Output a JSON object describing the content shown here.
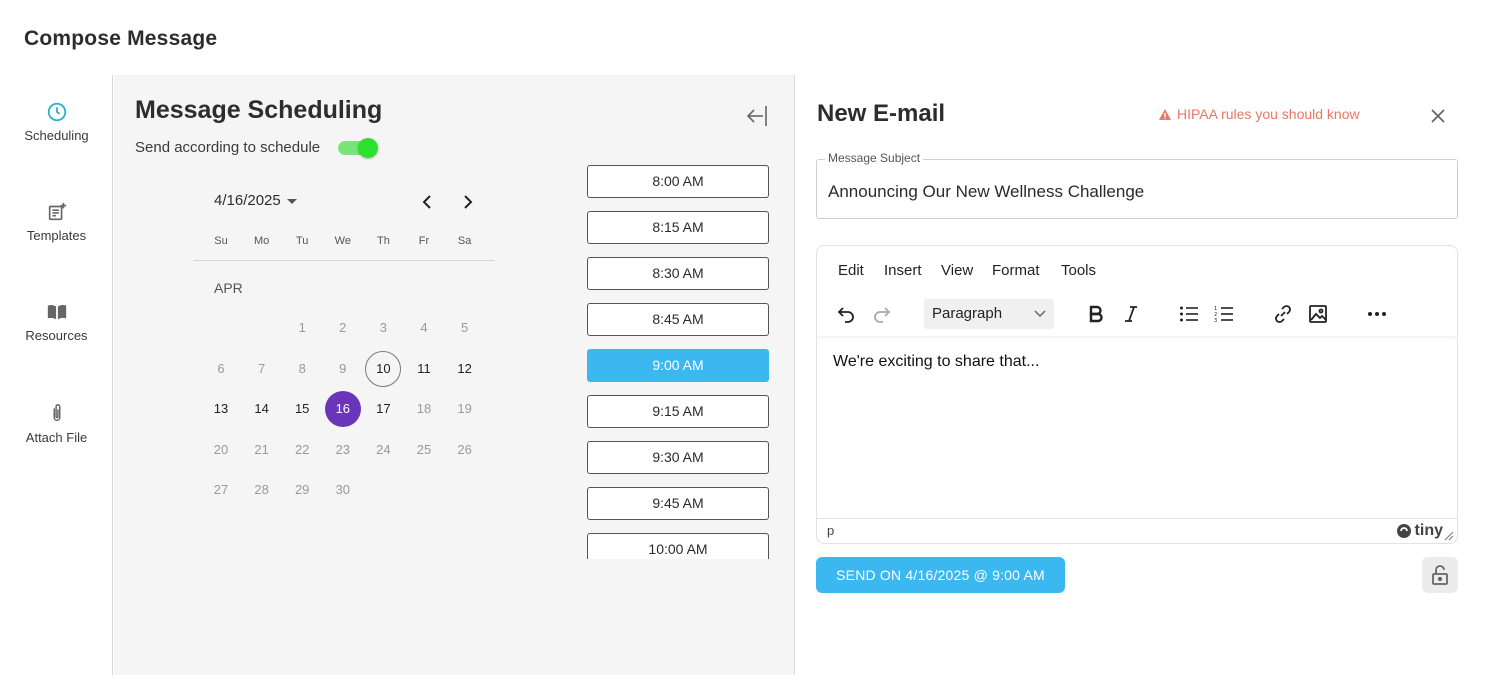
{
  "page": {
    "title": "Compose Message"
  },
  "rail": {
    "items": [
      {
        "label": "Scheduling",
        "icon": "clock-icon",
        "active": true
      },
      {
        "label": "Templates",
        "icon": "template-icon"
      },
      {
        "label": "Resources",
        "icon": "book-icon"
      },
      {
        "label": "Attach File",
        "icon": "paperclip-icon"
      }
    ]
  },
  "scheduling": {
    "title": "Message Scheduling",
    "toggle_label": "Send according to schedule",
    "toggle_on": true,
    "selected_date": "4/16/2025",
    "weekdays": [
      "Su",
      "Mo",
      "Tu",
      "We",
      "Th",
      "Fr",
      "Sa"
    ],
    "month_label": "APR",
    "days": [
      {
        "d": "1",
        "s": "muted"
      },
      {
        "d": "2",
        "s": "muted"
      },
      {
        "d": "3",
        "s": "muted"
      },
      {
        "d": "4",
        "s": "muted"
      },
      {
        "d": "5",
        "s": "muted"
      },
      {
        "d": "6",
        "s": "muted"
      },
      {
        "d": "7",
        "s": "muted"
      },
      {
        "d": "8",
        "s": "muted"
      },
      {
        "d": "9",
        "s": "muted"
      },
      {
        "d": "10",
        "s": "today"
      },
      {
        "d": "11",
        "s": "normal"
      },
      {
        "d": "12",
        "s": "normal"
      },
      {
        "d": "13",
        "s": "normal"
      },
      {
        "d": "14",
        "s": "normal"
      },
      {
        "d": "15",
        "s": "normal"
      },
      {
        "d": "16",
        "s": "selected"
      },
      {
        "d": "17",
        "s": "normal"
      },
      {
        "d": "18",
        "s": "muted"
      },
      {
        "d": "19",
        "s": "muted"
      },
      {
        "d": "20",
        "s": "muted"
      },
      {
        "d": "21",
        "s": "muted"
      },
      {
        "d": "22",
        "s": "muted"
      },
      {
        "d": "23",
        "s": "muted"
      },
      {
        "d": "24",
        "s": "muted"
      },
      {
        "d": "25",
        "s": "muted"
      },
      {
        "d": "26",
        "s": "muted"
      },
      {
        "d": "27",
        "s": "muted"
      },
      {
        "d": "28",
        "s": "muted"
      },
      {
        "d": "29",
        "s": "muted"
      },
      {
        "d": "30",
        "s": "muted"
      }
    ],
    "time_slots": [
      "8:00 AM",
      "8:15 AM",
      "8:30 AM",
      "8:45 AM",
      "9:00 AM",
      "9:15 AM",
      "9:30 AM",
      "9:45 AM",
      "10:00 AM"
    ],
    "selected_slot": "9:00 AM"
  },
  "email": {
    "title": "New E-mail",
    "hipaa_link": "HIPAA rules you should know",
    "subject_label": "Message Subject",
    "subject_value": "Announcing Our New Wellness Challenge",
    "menu": [
      "Edit",
      "Insert",
      "View",
      "Format",
      "Tools"
    ],
    "block_format": "Paragraph",
    "body": "We're exciting to share that...",
    "path": "p",
    "brand": "tiny",
    "send_label": "SEND ON 4/16/2025 @ 9:00 AM"
  },
  "colors": {
    "accent_blue": "#3cb8f0",
    "selected_day": "#6a35b8",
    "toggle_green": "#2ee02e",
    "warning": "#e87865",
    "clock_teal": "#2bb3c9"
  }
}
